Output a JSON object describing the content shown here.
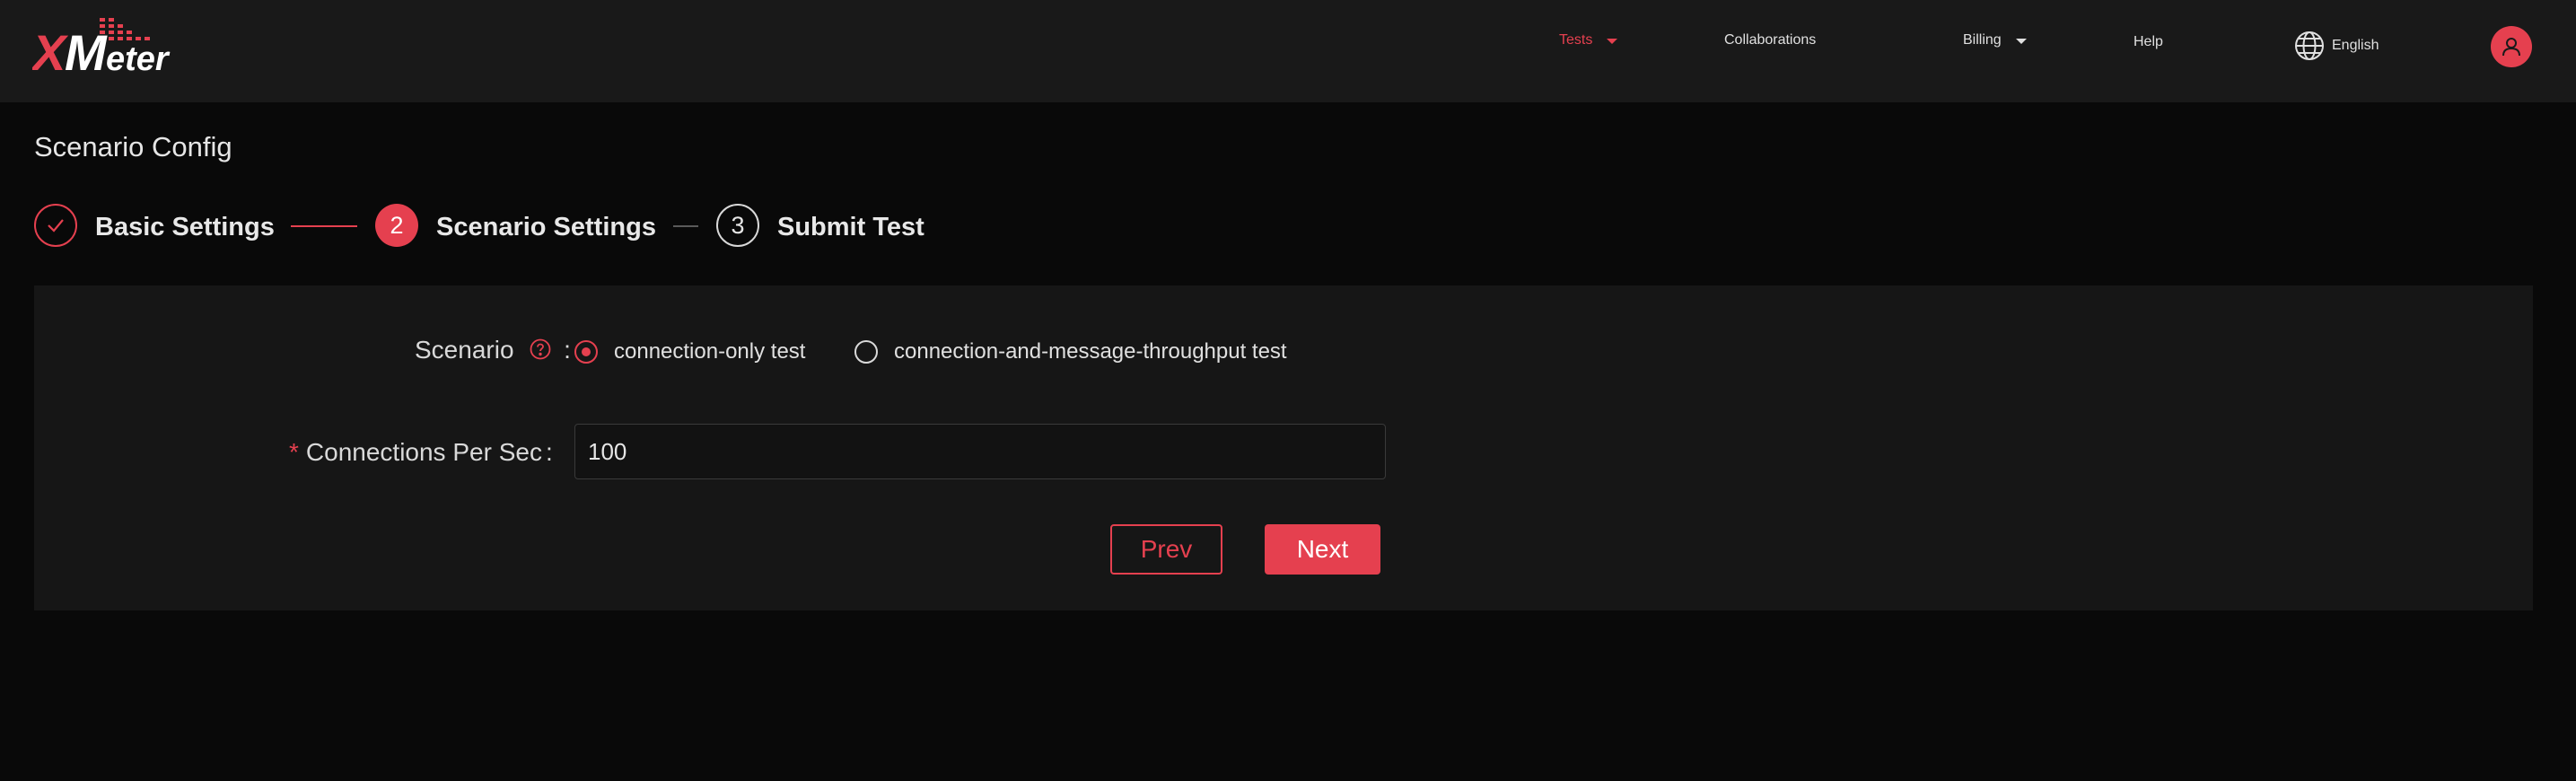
{
  "brand": {
    "logo_text": "XMeter",
    "accent_color": "#e5404f"
  },
  "nav": {
    "items": [
      {
        "label": "Tests",
        "active": true,
        "dropdown": true
      },
      {
        "label": "Collaborations",
        "active": false,
        "dropdown": false
      },
      {
        "label": "Billing",
        "active": false,
        "dropdown": true
      },
      {
        "label": "Help",
        "active": false,
        "dropdown": false
      }
    ],
    "language": "English",
    "language_icon": "globe-icon",
    "user_icon": "user-icon"
  },
  "page": {
    "title": "Scenario Config"
  },
  "steps": [
    {
      "number": "1",
      "label": "Basic Settings",
      "status": "finished",
      "icon": "check-icon"
    },
    {
      "number": "2",
      "label": "Scenario Settings",
      "status": "current"
    },
    {
      "number": "3",
      "label": "Submit Test",
      "status": "waiting"
    }
  ],
  "form": {
    "scenario": {
      "label": "Scenario",
      "help_icon": "question-circle-icon",
      "options": [
        {
          "label": "connection-only test",
          "checked": true
        },
        {
          "label": "connection-and-message-throughput test",
          "checked": false
        }
      ]
    },
    "connections": {
      "required_mark": "*",
      "label": "Connections Per Sec",
      "value": "100"
    },
    "colon": ":"
  },
  "buttons": {
    "prev": "Prev",
    "next": "Next"
  }
}
